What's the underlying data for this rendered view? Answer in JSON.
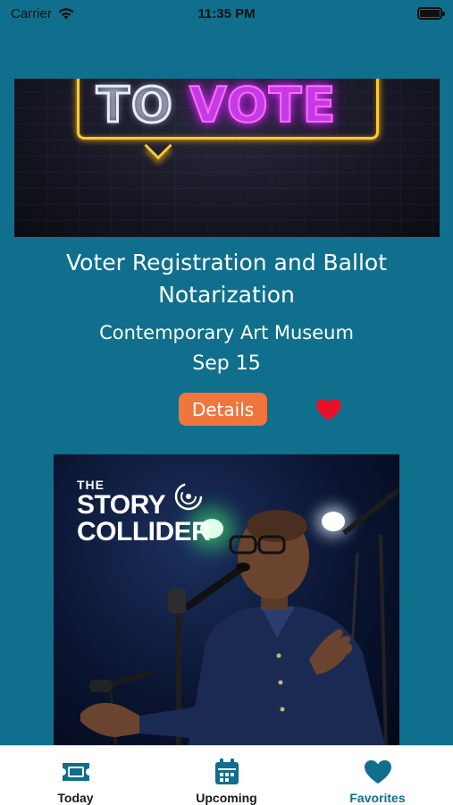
{
  "status_bar": {
    "carrier": "Carrier",
    "time": "11:35 PM"
  },
  "events": [
    {
      "image_text": "TO VOTE",
      "image_text_parts": [
        "TO",
        "VOTE"
      ],
      "title": "Voter Registration and Ballot Notarization",
      "venue": "Contemporary Art Museum",
      "date": "Sep 15",
      "details_label": "Details",
      "favorited": true
    },
    {
      "image_logo": {
        "line1": "THE",
        "line2": "STORY",
        "line3": "COLLIDER"
      }
    }
  ],
  "tab_bar": {
    "tabs": [
      {
        "label": "Today",
        "icon": "ticket-icon",
        "active": false
      },
      {
        "label": "Upcoming",
        "icon": "calendar-icon",
        "active": false
      },
      {
        "label": "Favorites",
        "icon": "heart-icon",
        "active": true
      }
    ]
  },
  "colors": {
    "background": "#0f6f8c",
    "details_button": "#f0763e",
    "heart": "#e8102a",
    "tab_active": "#0f6f8c"
  }
}
